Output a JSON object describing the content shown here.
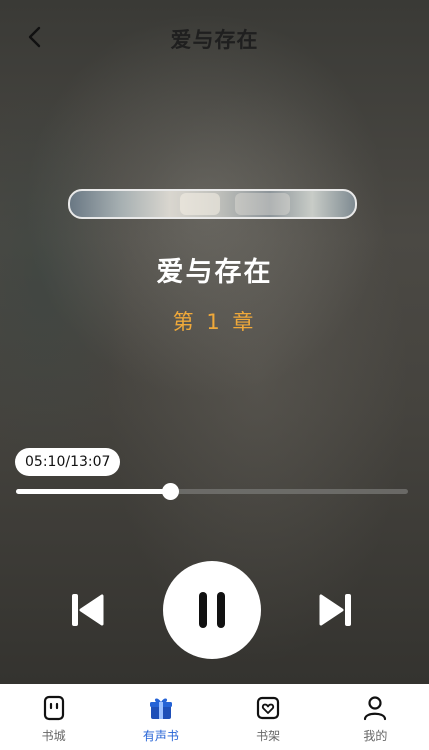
{
  "header": {
    "title": "爱与存在"
  },
  "book": {
    "title": "爱与存在",
    "chapter": "第 1 章"
  },
  "player": {
    "time_display": "05:10/13:07",
    "progress_fraction": 0.394,
    "state": "playing",
    "controls": {
      "prev_icon": "skip-previous-icon",
      "pause_icon": "pause-icon",
      "next_icon": "skip-next-icon"
    }
  },
  "tabs": [
    {
      "label": "书城",
      "icon": "bookstore-icon",
      "active": false
    },
    {
      "label": "有声书",
      "icon": "gift-icon",
      "active": true
    },
    {
      "label": "书架",
      "icon": "bookshelf-heart-icon",
      "active": false
    },
    {
      "label": "我的",
      "icon": "profile-icon",
      "active": false
    }
  ],
  "colors": {
    "accent": "#f0a93a",
    "active_tab": "#2563d6",
    "inactive_tab": "#666666",
    "title": "#ffffff"
  }
}
